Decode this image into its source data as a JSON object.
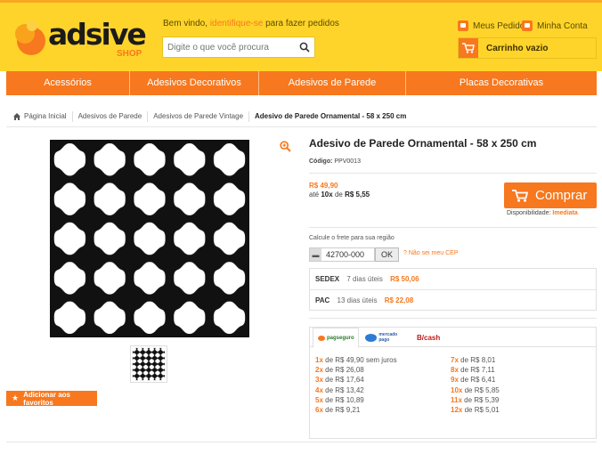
{
  "header": {
    "brand_name": "adsive",
    "brand_sub": "SHOP",
    "welcome_prefix": "Bem vindo,",
    "welcome_link": "identifique-se",
    "welcome_suffix": "para fazer pedidos",
    "search_placeholder": "Digite o que você procura",
    "my_orders": "Meus Pedidos",
    "my_account": "Minha Conta",
    "cart": "Carrinho vazio"
  },
  "nav": [
    "Acessórios",
    "Adesivos Decorativos",
    "Adesivos de Parede",
    "Placas Decorativas"
  ],
  "breadcrumb": [
    "Página Inicial",
    "Adesivos de Parede",
    "Adesivos de Parede Vintage",
    "Adesivo de Parede Ornamental - 58 x 250 cm"
  ],
  "product": {
    "title": "Adesivo de Parede Ornamental - 58 x 250 cm",
    "code_label": "Código:",
    "code": "PPV0013",
    "price": "R$ 49,90",
    "installment_prefix": "até",
    "installment_count": "10x",
    "installment_mid": "de",
    "installment_value": "R$ 5,55",
    "buy_label": "Comprar",
    "availability_label": "Disponibilidade:",
    "availability": "Imediata",
    "favorite_label": "Adicionar aos favoritos"
  },
  "freight": {
    "label": "Calcule o frete para sua região",
    "cep": "42700-000",
    "ok": "OK",
    "no_cep": "Não sei meu CEP",
    "options": [
      {
        "name": "SEDEX",
        "days": "7 dias úteis",
        "price": "R$ 50,06"
      },
      {
        "name": "PAC",
        "days": "13 dias úteis",
        "price": "R$ 22,08"
      }
    ]
  },
  "payment": {
    "tabs": [
      "pagseguro",
      "mercado pago",
      "B/cash"
    ],
    "col1": [
      {
        "n": "1x",
        "text": "de R$ 49,90 sem juros"
      },
      {
        "n": "2x",
        "text": "de R$ 26,08"
      },
      {
        "n": "3x",
        "text": "de R$ 17,64"
      },
      {
        "n": "4x",
        "text": "de R$ 13,42"
      },
      {
        "n": "5x",
        "text": "de R$ 10,89"
      },
      {
        "n": "6x",
        "text": "de R$ 9,21"
      }
    ],
    "col2": [
      {
        "n": "7x",
        "text": "de R$ 8,01"
      },
      {
        "n": "8x",
        "text": "de R$ 7,11"
      },
      {
        "n": "9x",
        "text": "de R$ 6,41"
      },
      {
        "n": "10x",
        "text": "de R$ 5,85"
      },
      {
        "n": "11x",
        "text": "de R$ 5,39"
      },
      {
        "n": "12x",
        "text": "de R$ 5,01"
      }
    ]
  },
  "colors": {
    "accent": "#f7781e",
    "header_bg": "#ffd42a"
  }
}
